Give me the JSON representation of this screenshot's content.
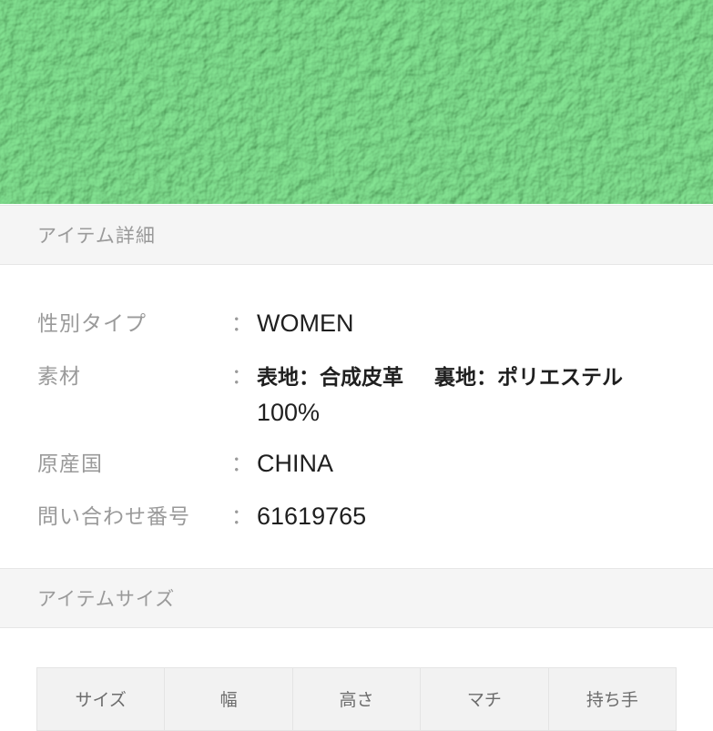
{
  "colors": {
    "leather": "#3fb052",
    "header_bg": "#f5f5f5",
    "label_text": "#9a9a9a",
    "value_text": "#1f1f1f"
  },
  "product_image": {
    "description": "green pebbled leather texture close-up"
  },
  "item_details": {
    "heading": "アイテム詳細",
    "rows": [
      {
        "label": "性別タイプ",
        "separator": "：",
        "value": "WOMEN"
      },
      {
        "label": "素材",
        "separator": "：",
        "value_part1": "表地：合成皮革",
        "value_part2": "裏地：ポリエステル",
        "value_part3": "100%"
      },
      {
        "label": "原産国",
        "separator": "：",
        "value": "CHINA"
      },
      {
        "label": "問い合わせ番号",
        "separator": "：",
        "value": "61619765"
      }
    ]
  },
  "item_size": {
    "heading": "アイテムサイズ",
    "columns": [
      "サイズ",
      "幅",
      "高さ",
      "マチ",
      "持ち手"
    ]
  }
}
